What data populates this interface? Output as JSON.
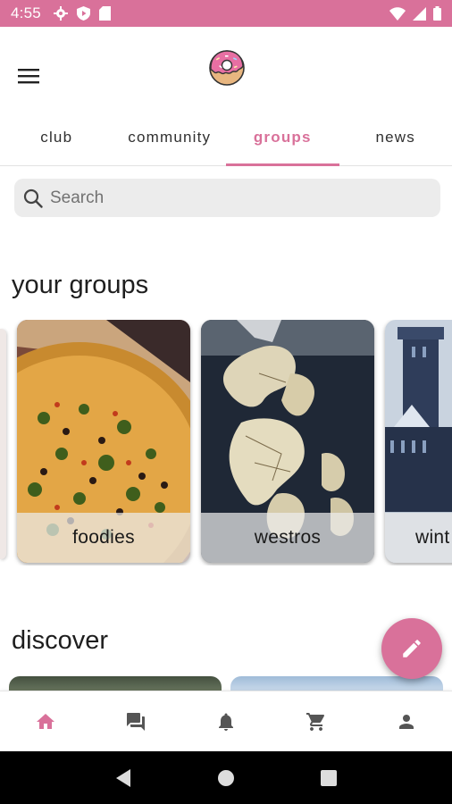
{
  "status_bar": {
    "time": "4:55",
    "left_icons": [
      "gear-icon",
      "shield-play-icon",
      "sd-card-icon"
    ],
    "right_icons": [
      "wifi-icon",
      "signal-icon",
      "battery-icon"
    ],
    "color": "#d9719a"
  },
  "app_bar": {
    "menu_icon": "hamburger-menu-icon",
    "logo": "donut-logo"
  },
  "tabs": [
    {
      "label": "club",
      "active": false
    },
    {
      "label": "community",
      "active": false
    },
    {
      "label": "groups",
      "active": true
    },
    {
      "label": "news",
      "active": false
    }
  ],
  "search": {
    "placeholder": "Search",
    "value": "",
    "icon": "search-icon"
  },
  "sections": {
    "your_groups_title": "your groups",
    "discover_title": "discover"
  },
  "groups": [
    {
      "name": "foodies",
      "image": "pizza-photo"
    },
    {
      "name": "westros",
      "image": "map-photo"
    },
    {
      "name": "wint",
      "image": "castle-photo"
    }
  ],
  "fab": {
    "icon": "pencil-icon",
    "color": "#d9719a"
  },
  "bottom_nav": [
    {
      "icon": "home-icon",
      "active": true
    },
    {
      "icon": "chat-icon",
      "active": false
    },
    {
      "icon": "bell-icon",
      "active": false
    },
    {
      "icon": "cart-icon",
      "active": false
    },
    {
      "icon": "person-icon",
      "active": false
    }
  ],
  "colors": {
    "accent": "#d9719a",
    "nav_inactive": "#555555",
    "search_bg": "#ececec"
  }
}
